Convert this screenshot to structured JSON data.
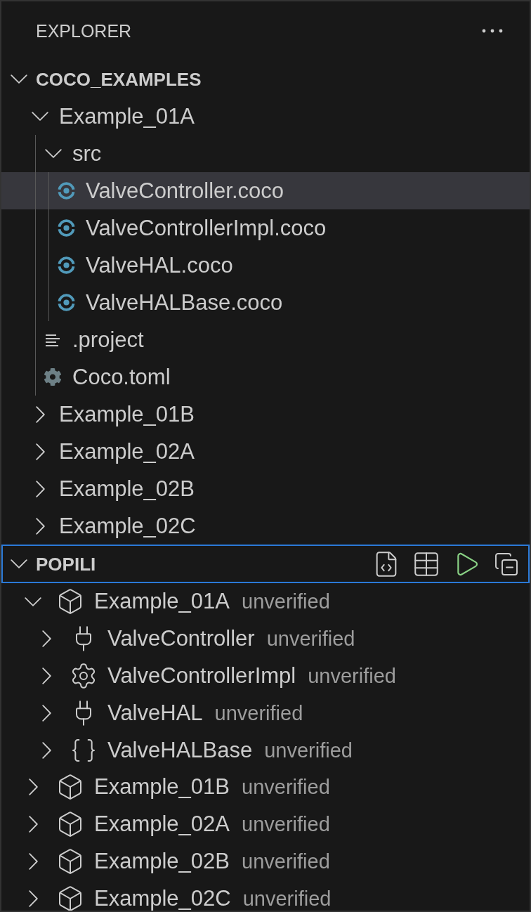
{
  "header": {
    "title": "EXPLORER"
  },
  "sections": [
    {
      "kind": "files",
      "title": "COCO_EXAMPLES",
      "expanded": true,
      "focused": false,
      "items": [
        {
          "kind": "folder",
          "label": "Example_01A",
          "expanded": true,
          "selected": false,
          "children": [
            {
              "kind": "folder",
              "label": "src",
              "expanded": true,
              "selected": false,
              "children": [
                {
                  "kind": "coco",
                  "label": "ValveController.coco",
                  "selected": true
                },
                {
                  "kind": "coco",
                  "label": "ValveControllerImpl.coco",
                  "selected": false
                },
                {
                  "kind": "coco",
                  "label": "ValveHAL.coco",
                  "selected": false
                },
                {
                  "kind": "coco",
                  "label": "ValveHALBase.coco",
                  "selected": false
                }
              ]
            },
            {
              "kind": "text",
              "label": ".project",
              "selected": false
            },
            {
              "kind": "config",
              "label": "Coco.toml",
              "selected": false
            }
          ]
        },
        {
          "kind": "folder",
          "label": "Example_01B",
          "expanded": false,
          "selected": false
        },
        {
          "kind": "folder",
          "label": "Example_02A",
          "expanded": false,
          "selected": false
        },
        {
          "kind": "folder",
          "label": "Example_02B",
          "expanded": false,
          "selected": false
        },
        {
          "kind": "folder",
          "label": "Example_02C",
          "expanded": false,
          "selected": false
        }
      ]
    },
    {
      "kind": "components",
      "title": "POPILI",
      "expanded": true,
      "focused": true,
      "items": [
        {
          "kind": "package",
          "label": "Example_01A",
          "status": "unverified",
          "expanded": true,
          "selected": false,
          "children": [
            {
              "kind": "port",
              "label": "ValveController",
              "status": "unverified",
              "expanded": false,
              "selected": false
            },
            {
              "kind": "component",
              "label": "ValveControllerImpl",
              "status": "unverified",
              "expanded": false,
              "selected": false
            },
            {
              "kind": "port",
              "label": "ValveHAL",
              "status": "unverified",
              "expanded": false,
              "selected": false
            },
            {
              "kind": "struct",
              "label": "ValveHALBase",
              "status": "unverified",
              "expanded": false,
              "selected": false
            }
          ]
        },
        {
          "kind": "package",
          "label": "Example_01B",
          "status": "unverified",
          "expanded": false,
          "selected": false
        },
        {
          "kind": "package",
          "label": "Example_02A",
          "status": "unverified",
          "expanded": false,
          "selected": false
        },
        {
          "kind": "package",
          "label": "Example_02B",
          "status": "unverified",
          "expanded": false,
          "selected": false
        },
        {
          "kind": "package",
          "label": "Example_02C",
          "status": "unverified",
          "expanded": false,
          "selected": false
        }
      ]
    }
  ]
}
